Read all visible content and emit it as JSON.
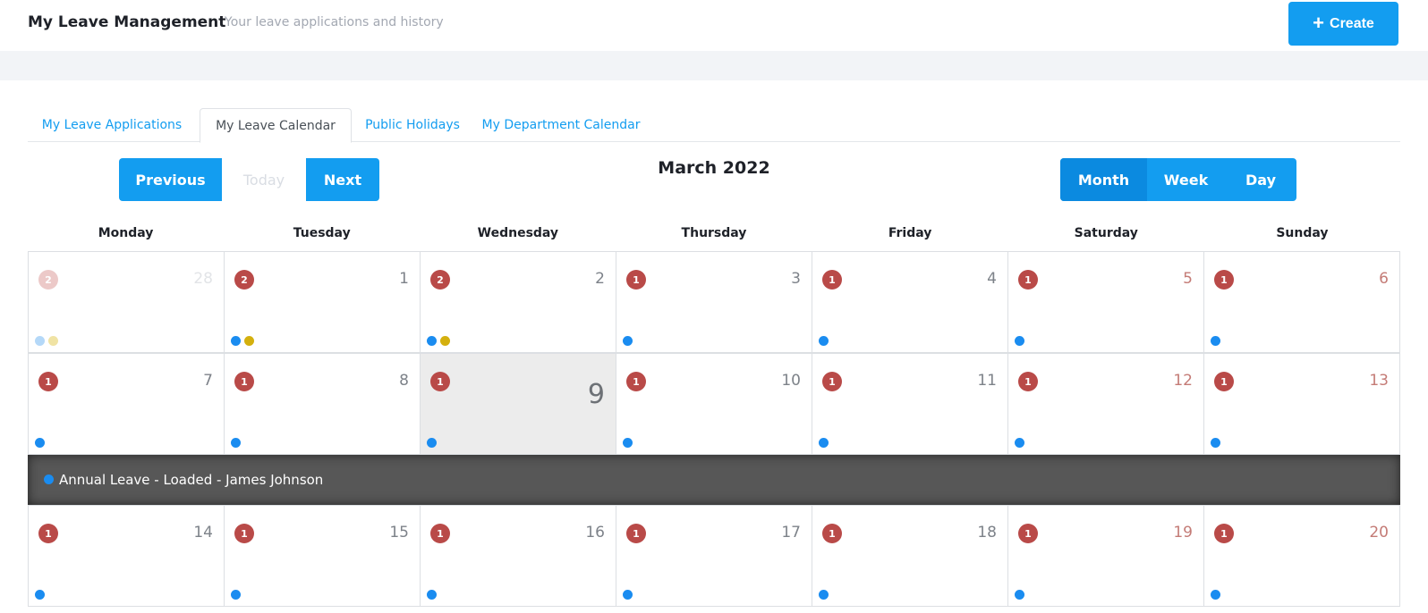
{
  "header": {
    "title": "My Leave Management",
    "subtitle": "Your leave applications and history",
    "create_label": "Create"
  },
  "tabs": [
    {
      "label": "My Leave Applications"
    },
    {
      "label": "My Leave Calendar"
    },
    {
      "label": "Public Holidays"
    },
    {
      "label": "My Department Calendar"
    }
  ],
  "toolbar": {
    "previous": "Previous",
    "today": "Today",
    "next": "Next",
    "title": "March 2022",
    "views": {
      "month": "Month",
      "week": "Week",
      "day": "Day"
    },
    "active_view": "Month"
  },
  "weekdays": [
    "Monday",
    "Tuesday",
    "Wednesday",
    "Thursday",
    "Friday",
    "Saturday",
    "Sunday"
  ],
  "weeks": [
    [
      {
        "num": "28",
        "badge": "2",
        "dots": [
          "blue",
          "gold"
        ],
        "faded": true
      },
      {
        "num": "1",
        "badge": "2",
        "dots": [
          "blue",
          "gold"
        ]
      },
      {
        "num": "2",
        "badge": "2",
        "dots": [
          "blue",
          "gold"
        ]
      },
      {
        "num": "3",
        "badge": "1",
        "dots": [
          "blue"
        ]
      },
      {
        "num": "4",
        "badge": "1",
        "dots": [
          "blue"
        ]
      },
      {
        "num": "5",
        "badge": "1",
        "dots": [
          "blue"
        ],
        "weekend": true
      },
      {
        "num": "6",
        "badge": "1",
        "dots": [
          "blue"
        ],
        "weekend": true
      }
    ],
    [
      {
        "num": "7",
        "badge": "1",
        "dots": [
          "blue"
        ]
      },
      {
        "num": "8",
        "badge": "1",
        "dots": [
          "blue"
        ]
      },
      {
        "num": "9",
        "badge": "1",
        "dots": [
          "blue"
        ],
        "today": true
      },
      {
        "num": "10",
        "badge": "1",
        "dots": [
          "blue"
        ]
      },
      {
        "num": "11",
        "badge": "1",
        "dots": [
          "blue"
        ]
      },
      {
        "num": "12",
        "badge": "1",
        "dots": [
          "blue"
        ],
        "weekend": true
      },
      {
        "num": "13",
        "badge": "1",
        "dots": [
          "blue"
        ],
        "weekend": true
      }
    ],
    [
      {
        "num": "14",
        "badge": "1",
        "dots": [
          "blue"
        ]
      },
      {
        "num": "15",
        "badge": "1",
        "dots": [
          "blue"
        ]
      },
      {
        "num": "16",
        "badge": "1",
        "dots": [
          "blue"
        ]
      },
      {
        "num": "17",
        "badge": "1",
        "dots": [
          "blue"
        ]
      },
      {
        "num": "18",
        "badge": "1",
        "dots": [
          "blue"
        ]
      },
      {
        "num": "19",
        "badge": "1",
        "dots": [
          "blue"
        ],
        "weekend": true
      },
      {
        "num": "20",
        "badge": "1",
        "dots": [
          "blue"
        ],
        "weekend": true
      }
    ]
  ],
  "event_detail": {
    "text": "Annual Leave - Loaded - James Johnson",
    "dot_color": "#1a8cf0"
  },
  "colors": {
    "accent": "#139df0",
    "badge": "#b94a48",
    "dot_blue": "#1a8cf0",
    "dot_gold": "#d4b00e",
    "event_bar": "#575757"
  }
}
